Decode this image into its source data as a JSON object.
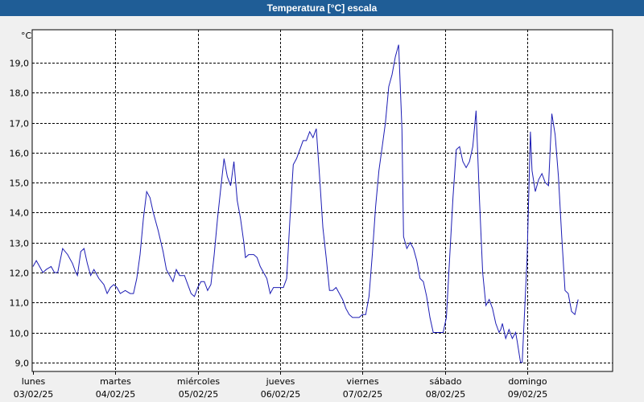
{
  "window": {
    "title": "Temperatura [°C] escala"
  },
  "colors": {
    "title_bar": "#1f5d96",
    "plot_bg": "#ffffff",
    "line": "#1c1cb4",
    "grid": "#000000"
  },
  "chart_data": {
    "type": "line",
    "title": "Temperatura [°C] escala",
    "ylabel": "°C",
    "xlabel": "",
    "ylim": [
      8.7,
      20.1
    ],
    "xlim": [
      0,
      7.0
    ],
    "y_ticks": [
      "9,0",
      "10,0",
      "11,0",
      "12,0",
      "13,0",
      "14,0",
      "15,0",
      "16,0",
      "17,0",
      "18,0",
      "19,0"
    ],
    "y_tick_values": [
      9,
      10,
      11,
      12,
      13,
      14,
      15,
      16,
      17,
      18,
      19
    ],
    "x_ticks": [
      {
        "day": "lunes",
        "date": "03/02/25"
      },
      {
        "day": "martes",
        "date": "04/02/25"
      },
      {
        "day": "miércoles",
        "date": "05/02/25"
      },
      {
        "day": "jueves",
        "date": "06/02/25"
      },
      {
        "day": "viernes",
        "date": "07/02/25"
      },
      {
        "day": "sábado",
        "date": "08/02/25"
      },
      {
        "day": "domingo",
        "date": "09/02/25"
      }
    ],
    "grid": true,
    "series": [
      {
        "points": [
          [
            0.0,
            12.2
          ],
          [
            0.04,
            12.4
          ],
          [
            0.08,
            12.2
          ],
          [
            0.12,
            12.0
          ],
          [
            0.16,
            12.1
          ],
          [
            0.22,
            12.2
          ],
          [
            0.26,
            12.0
          ],
          [
            0.3,
            12.0
          ],
          [
            0.36,
            12.8
          ],
          [
            0.42,
            12.6
          ],
          [
            0.48,
            12.3
          ],
          [
            0.52,
            12.0
          ],
          [
            0.54,
            11.9
          ],
          [
            0.58,
            12.7
          ],
          [
            0.62,
            12.8
          ],
          [
            0.66,
            12.3
          ],
          [
            0.7,
            11.9
          ],
          [
            0.74,
            12.1
          ],
          [
            0.8,
            11.8
          ],
          [
            0.86,
            11.6
          ],
          [
            0.9,
            11.3
          ],
          [
            0.94,
            11.5
          ],
          [
            0.98,
            11.6
          ],
          [
            1.02,
            11.5
          ],
          [
            1.06,
            11.3
          ],
          [
            1.12,
            11.4
          ],
          [
            1.18,
            11.3
          ],
          [
            1.22,
            11.3
          ],
          [
            1.26,
            11.8
          ],
          [
            1.3,
            12.6
          ],
          [
            1.34,
            13.8
          ],
          [
            1.38,
            14.7
          ],
          [
            1.42,
            14.5
          ],
          [
            1.46,
            14.0
          ],
          [
            1.52,
            13.4
          ],
          [
            1.58,
            12.7
          ],
          [
            1.62,
            12.1
          ],
          [
            1.66,
            11.9
          ],
          [
            1.7,
            11.7
          ],
          [
            1.74,
            12.1
          ],
          [
            1.78,
            11.9
          ],
          [
            1.84,
            11.9
          ],
          [
            1.88,
            11.6
          ],
          [
            1.92,
            11.3
          ],
          [
            1.96,
            11.2
          ],
          [
            2.0,
            11.5
          ],
          [
            2.04,
            11.7
          ],
          [
            2.08,
            11.7
          ],
          [
            2.12,
            11.4
          ],
          [
            2.16,
            11.6
          ],
          [
            2.2,
            12.6
          ],
          [
            2.24,
            13.8
          ],
          [
            2.28,
            14.8
          ],
          [
            2.32,
            15.8
          ],
          [
            2.36,
            15.2
          ],
          [
            2.4,
            14.9
          ],
          [
            2.44,
            15.7
          ],
          [
            2.48,
            14.4
          ],
          [
            2.52,
            13.8
          ],
          [
            2.56,
            13.0
          ],
          [
            2.58,
            12.5
          ],
          [
            2.62,
            12.6
          ],
          [
            2.68,
            12.6
          ],
          [
            2.72,
            12.5
          ],
          [
            2.76,
            12.2
          ],
          [
            2.8,
            12.0
          ],
          [
            2.84,
            11.8
          ],
          [
            2.88,
            11.3
          ],
          [
            2.92,
            11.5
          ],
          [
            2.96,
            11.5
          ],
          [
            3.0,
            11.5
          ],
          [
            3.04,
            11.5
          ],
          [
            3.08,
            11.8
          ],
          [
            3.12,
            13.8
          ],
          [
            3.16,
            15.6
          ],
          [
            3.2,
            15.8
          ],
          [
            3.24,
            16.1
          ],
          [
            3.28,
            16.4
          ],
          [
            3.32,
            16.4
          ],
          [
            3.36,
            16.7
          ],
          [
            3.4,
            16.5
          ],
          [
            3.44,
            16.8
          ],
          [
            3.48,
            15.2
          ],
          [
            3.52,
            13.5
          ],
          [
            3.56,
            12.5
          ],
          [
            3.6,
            11.4
          ],
          [
            3.64,
            11.4
          ],
          [
            3.68,
            11.5
          ],
          [
            3.72,
            11.3
          ],
          [
            3.76,
            11.1
          ],
          [
            3.8,
            10.8
          ],
          [
            3.84,
            10.6
          ],
          [
            3.88,
            10.5
          ],
          [
            3.92,
            10.5
          ],
          [
            3.96,
            10.5
          ],
          [
            4.0,
            10.6
          ],
          [
            4.04,
            10.6
          ],
          [
            4.08,
            11.2
          ],
          [
            4.12,
            12.6
          ],
          [
            4.16,
            14.2
          ],
          [
            4.2,
            15.4
          ],
          [
            4.24,
            16.2
          ],
          [
            4.28,
            17.0
          ],
          [
            4.32,
            18.2
          ],
          [
            4.36,
            18.6
          ],
          [
            4.4,
            19.2
          ],
          [
            4.44,
            19.6
          ],
          [
            4.48,
            16.8
          ],
          [
            4.5,
            13.2
          ],
          [
            4.54,
            12.8
          ],
          [
            4.58,
            13.0
          ],
          [
            4.62,
            12.8
          ],
          [
            4.66,
            12.4
          ],
          [
            4.7,
            11.8
          ],
          [
            4.74,
            11.7
          ],
          [
            4.78,
            11.2
          ],
          [
            4.82,
            10.5
          ],
          [
            4.86,
            10.0
          ],
          [
            4.9,
            10.0
          ],
          [
            4.94,
            10.0
          ],
          [
            4.98,
            10.0
          ],
          [
            5.02,
            10.5
          ],
          [
            5.06,
            12.5
          ],
          [
            5.1,
            14.5
          ],
          [
            5.14,
            16.1
          ],
          [
            5.18,
            16.2
          ],
          [
            5.22,
            15.7
          ],
          [
            5.26,
            15.5
          ],
          [
            5.3,
            15.7
          ],
          [
            5.34,
            16.2
          ],
          [
            5.38,
            17.4
          ],
          [
            5.42,
            14.5
          ],
          [
            5.46,
            12.0
          ],
          [
            5.5,
            10.9
          ],
          [
            5.54,
            11.1
          ],
          [
            5.58,
            10.8
          ],
          [
            5.62,
            10.3
          ],
          [
            5.66,
            10.0
          ],
          [
            5.68,
            10.1
          ],
          [
            5.7,
            10.3
          ],
          [
            5.74,
            9.8
          ],
          [
            5.78,
            10.1
          ],
          [
            5.82,
            9.8
          ],
          [
            5.86,
            10.0
          ],
          [
            5.88,
            9.7
          ],
          [
            5.92,
            9.0
          ],
          [
            5.94,
            9.0
          ],
          [
            6.0,
            12.5
          ],
          [
            6.04,
            16.7
          ],
          [
            6.06,
            15.4
          ],
          [
            6.1,
            14.7
          ],
          [
            6.14,
            15.1
          ],
          [
            6.18,
            15.3
          ],
          [
            6.22,
            15.0
          ],
          [
            6.26,
            14.9
          ],
          [
            6.3,
            17.3
          ],
          [
            6.34,
            16.6
          ],
          [
            6.38,
            15.2
          ],
          [
            6.42,
            13.2
          ],
          [
            6.46,
            11.4
          ],
          [
            6.5,
            11.3
          ],
          [
            6.54,
            10.7
          ],
          [
            6.58,
            10.6
          ],
          [
            6.62,
            11.1
          ]
        ]
      }
    ]
  }
}
